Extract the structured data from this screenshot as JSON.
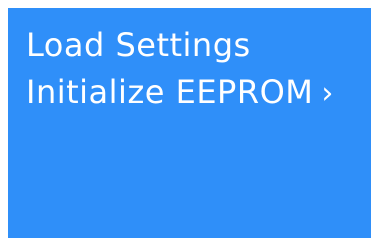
{
  "screen": {
    "background_color": "#2f8ff9",
    "text_color": "#ffffff",
    "menu": [
      {
        "label": "Load Settings"
      },
      {
        "label": "Initialize EEPROM",
        "submenu_icon": "chevron-right-icon",
        "submenu_glyph": "›"
      }
    ]
  }
}
